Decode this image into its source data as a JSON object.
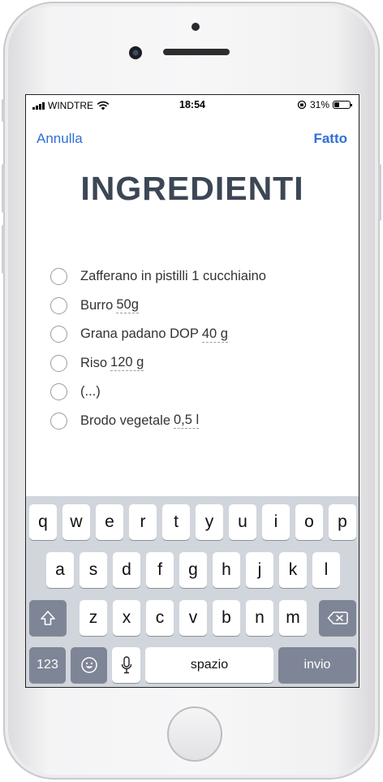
{
  "status": {
    "carrier": "WINDTRE",
    "time": "18:54",
    "battery": "31%"
  },
  "nav": {
    "cancel": "Annulla",
    "done": "Fatto"
  },
  "title": "INGREDIENTI",
  "ingredients": [
    {
      "name": "Zafferano in pistilli 1 cucchiaino",
      "qty": ""
    },
    {
      "name": "Burro",
      "qty": "50g"
    },
    {
      "name": "Grana padano DOP",
      "qty": "40 g"
    },
    {
      "name": "Riso",
      "qty": "120 g"
    },
    {
      "name": "(...)",
      "qty": ""
    },
    {
      "name": "Brodo vegetale",
      "qty": "0,5 l"
    }
  ],
  "keyboard": {
    "row1": [
      "q",
      "w",
      "e",
      "r",
      "t",
      "y",
      "u",
      "i",
      "o",
      "p"
    ],
    "row2": [
      "a",
      "s",
      "d",
      "f",
      "g",
      "h",
      "j",
      "k",
      "l"
    ],
    "row3": [
      "z",
      "x",
      "c",
      "v",
      "b",
      "n",
      "m"
    ],
    "numbers": "123",
    "space": "spazio",
    "return": "invio",
    "icons": {
      "shift": "shift-icon",
      "delete": "backspace-icon",
      "emoji": "emoji-icon",
      "mic": "microphone-icon"
    }
  }
}
